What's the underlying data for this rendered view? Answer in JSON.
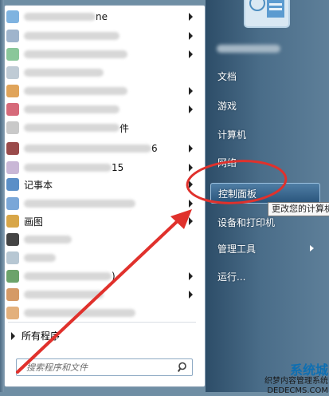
{
  "programs": [
    {
      "label": "",
      "blur_w": 90,
      "suffix": "ne",
      "icon": "#7fb3e0",
      "arrow": true
    },
    {
      "label": "",
      "blur_w": 120,
      "suffix": "",
      "icon": "#9fb4cc",
      "arrow": true
    },
    {
      "label": "",
      "blur_w": 130,
      "suffix": "",
      "icon": "#8ac79a",
      "arrow": true
    },
    {
      "label": "",
      "blur_w": 100,
      "suffix": "",
      "icon": "#bfcbd5",
      "arrow": false
    },
    {
      "label": "",
      "blur_w": 130,
      "suffix": "",
      "icon": "#e0a45a",
      "arrow": true
    },
    {
      "label": "",
      "blur_w": 120,
      "suffix": "",
      "icon": "#d66a7a",
      "arrow": true
    },
    {
      "label": "",
      "blur_w": 120,
      "suffix": "件",
      "icon": "#c9c9c9",
      "arrow": false
    },
    {
      "label": "",
      "blur_w": 160,
      "suffix": "6",
      "icon": "#9a4b4b",
      "arrow": true
    },
    {
      "label": "",
      "blur_w": 110,
      "suffix": "15",
      "icon": "#c9b7d6",
      "arrow": true
    },
    {
      "label": "记事本",
      "blur_w": 0,
      "suffix": "",
      "icon": "#5b8fc7",
      "arrow": true
    },
    {
      "label": "",
      "blur_w": 140,
      "suffix": "",
      "icon": "#7aa7d8",
      "arrow": true
    },
    {
      "label": "画图",
      "blur_w": 0,
      "suffix": "",
      "icon": "#d8a648",
      "arrow": true
    },
    {
      "label": "",
      "blur_w": 60,
      "suffix": "",
      "icon": "#444444",
      "arrow": false
    },
    {
      "label": "",
      "blur_w": 40,
      "suffix": "",
      "icon": "#b7c7d3",
      "arrow": false
    },
    {
      "label": "",
      "blur_w": 110,
      "suffix": ")",
      "icon": "#6ca36a",
      "arrow": true
    },
    {
      "label": "",
      "blur_w": 100,
      "suffix": "",
      "icon": "#d59a66",
      "arrow": true
    },
    {
      "label": "",
      "blur_w": 140,
      "suffix": "",
      "icon": "#e3b07c",
      "arrow": false
    }
  ],
  "all_programs": "所有程序",
  "search": {
    "placeholder": "搜索程序和文件"
  },
  "right_items": [
    {
      "label": "文档",
      "arrow": false
    },
    {
      "label": "游戏",
      "arrow": false
    },
    {
      "label": "计算机",
      "arrow": false
    },
    {
      "label": "网络",
      "arrow": false
    },
    {
      "label": "控制面板",
      "arrow": false
    },
    {
      "label": "设备和打印机",
      "arrow": false
    },
    {
      "label": "管理工具",
      "arrow": true
    },
    {
      "label": "运行...",
      "arrow": false
    }
  ],
  "tooltip": "更改您的计算机",
  "watermark": {
    "line1": "系统城",
    "line2": "织梦内容管理系统",
    "line3": "DEDECMS.COM"
  },
  "colors": {
    "annotation": "#e0312c"
  }
}
